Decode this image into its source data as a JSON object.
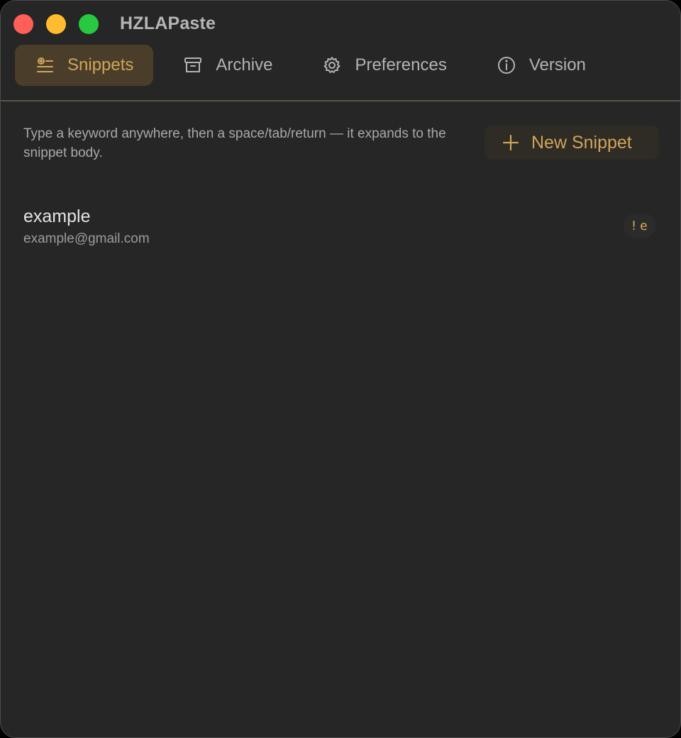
{
  "window": {
    "title": "HZLAPaste",
    "traffic_colors": {
      "close": "#fe5f57",
      "minimize": "#febc2e",
      "maximize": "#28c840"
    }
  },
  "tabs": [
    {
      "label": "Snippets",
      "icon": "snippets-icon",
      "active": true
    },
    {
      "label": "Archive",
      "icon": "archive-icon",
      "active": false
    },
    {
      "label": "Preferences",
      "icon": "gear-icon",
      "active": false
    },
    {
      "label": "Version",
      "icon": "info-icon",
      "active": false
    }
  ],
  "snippets_page": {
    "hint": "Type a keyword anywhere, then a space/tab/return — it expands to the snippet body.",
    "new_button_label": "New Snippet",
    "items": [
      {
        "name": "example",
        "body": "example@gmail.com",
        "keyword": "!e"
      }
    ]
  },
  "colors": {
    "accent": "#cfa55a",
    "background": "#262626",
    "active_tab_bg": "#4a3e2a"
  }
}
